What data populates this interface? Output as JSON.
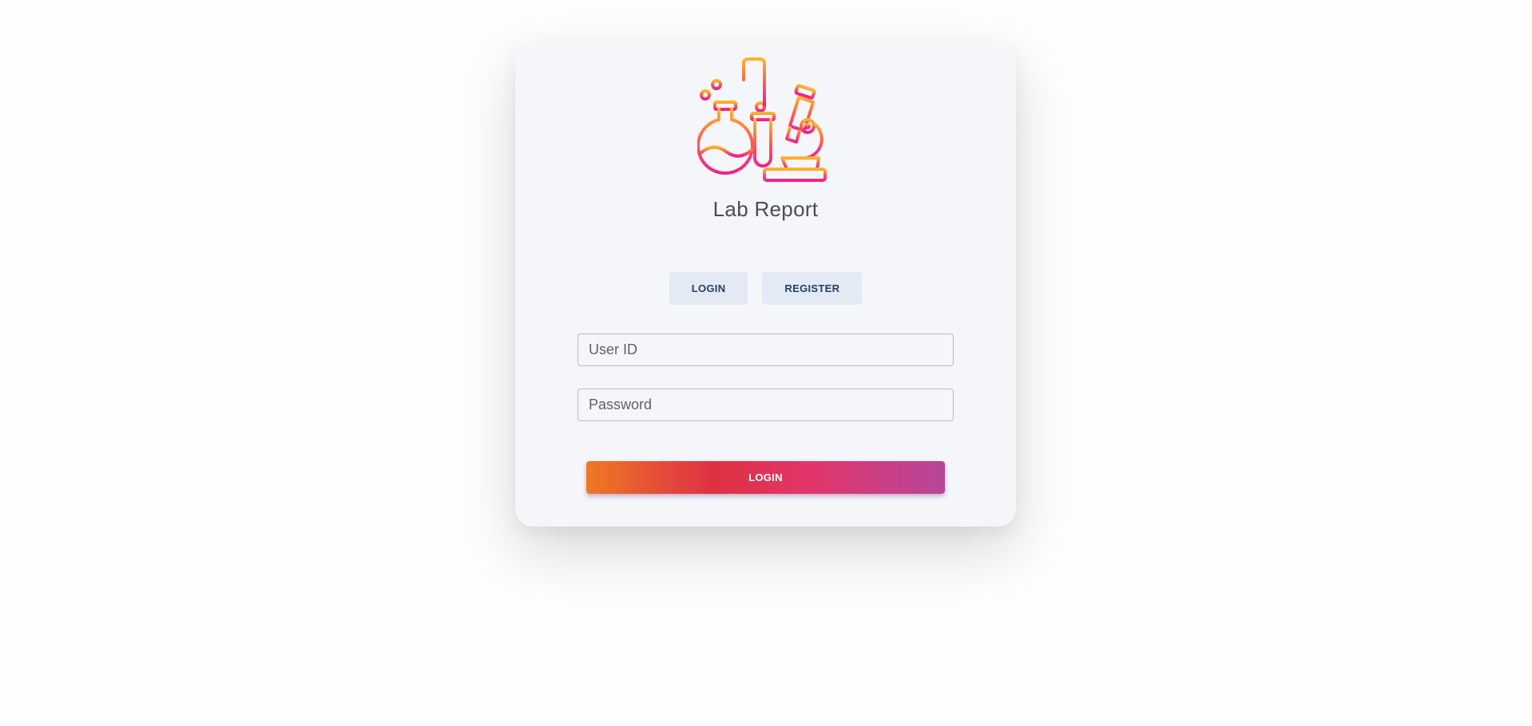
{
  "app": {
    "title": "Lab Report",
    "logo_icon": "lab-flask-microscope-icon"
  },
  "tabs": [
    {
      "label": "LOGIN"
    },
    {
      "label": "REGISTER"
    }
  ],
  "form": {
    "user_id_placeholder": "User ID",
    "user_id_value": "",
    "password_placeholder": "Password",
    "password_value": "",
    "submit_label": "LOGIN"
  },
  "colors": {
    "accent_start": "#ee7a22",
    "accent_mid": "#de3142",
    "accent_end": "#b6479a",
    "tab_bg": "#e3eaf4",
    "tab_text": "#24406a",
    "title_text": "#4a4d55"
  }
}
